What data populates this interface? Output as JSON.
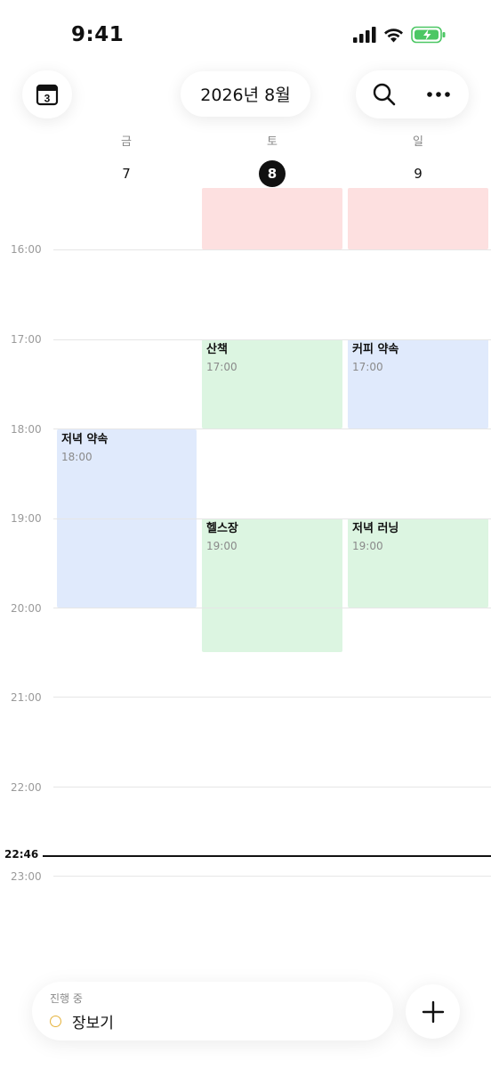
{
  "status_bar": {
    "time": "9:41",
    "icons": [
      "signal-icon",
      "wifi-icon",
      "battery-charging-icon"
    ],
    "battery_color": "#4cc764"
  },
  "header": {
    "calendar_icon_day": "3",
    "month_title": "2026년 8월",
    "icons": [
      "search-icon",
      "more-icon"
    ]
  },
  "days": [
    {
      "name": "금",
      "number": "7",
      "today": false
    },
    {
      "name": "토",
      "number": "8",
      "today": true
    },
    {
      "name": "일",
      "number": "9",
      "today": false
    }
  ],
  "hours": [
    "16:00",
    "17:00",
    "18:00",
    "19:00",
    "20:00",
    "21:00",
    "22:00",
    "23:00"
  ],
  "events": [
    {
      "day": "토",
      "title": "",
      "time": "",
      "color": "#fde0e0"
    },
    {
      "day": "일",
      "title": "",
      "time": "",
      "color": "#fde0e0"
    },
    {
      "day": "토",
      "title": "산책",
      "time": "17:00",
      "color": "#dcf5e1"
    },
    {
      "day": "일",
      "title": "커피 약속",
      "time": "17:00",
      "color": "#e0eafc"
    },
    {
      "day": "금",
      "title": "저녁 약속",
      "time": "18:00",
      "color": "#e0eafc"
    },
    {
      "day": "토",
      "title": "헬스장",
      "time": "19:00",
      "color": "#dcf5e1"
    },
    {
      "day": "일",
      "title": "저녁 러닝",
      "time": "19:00",
      "color": "#dcf5e1"
    }
  ],
  "now_indicator": "22:46",
  "in_progress": {
    "label": "진행 중",
    "task": "장보기",
    "accent": "#e5b23a"
  },
  "fab_icon": "plus-icon"
}
